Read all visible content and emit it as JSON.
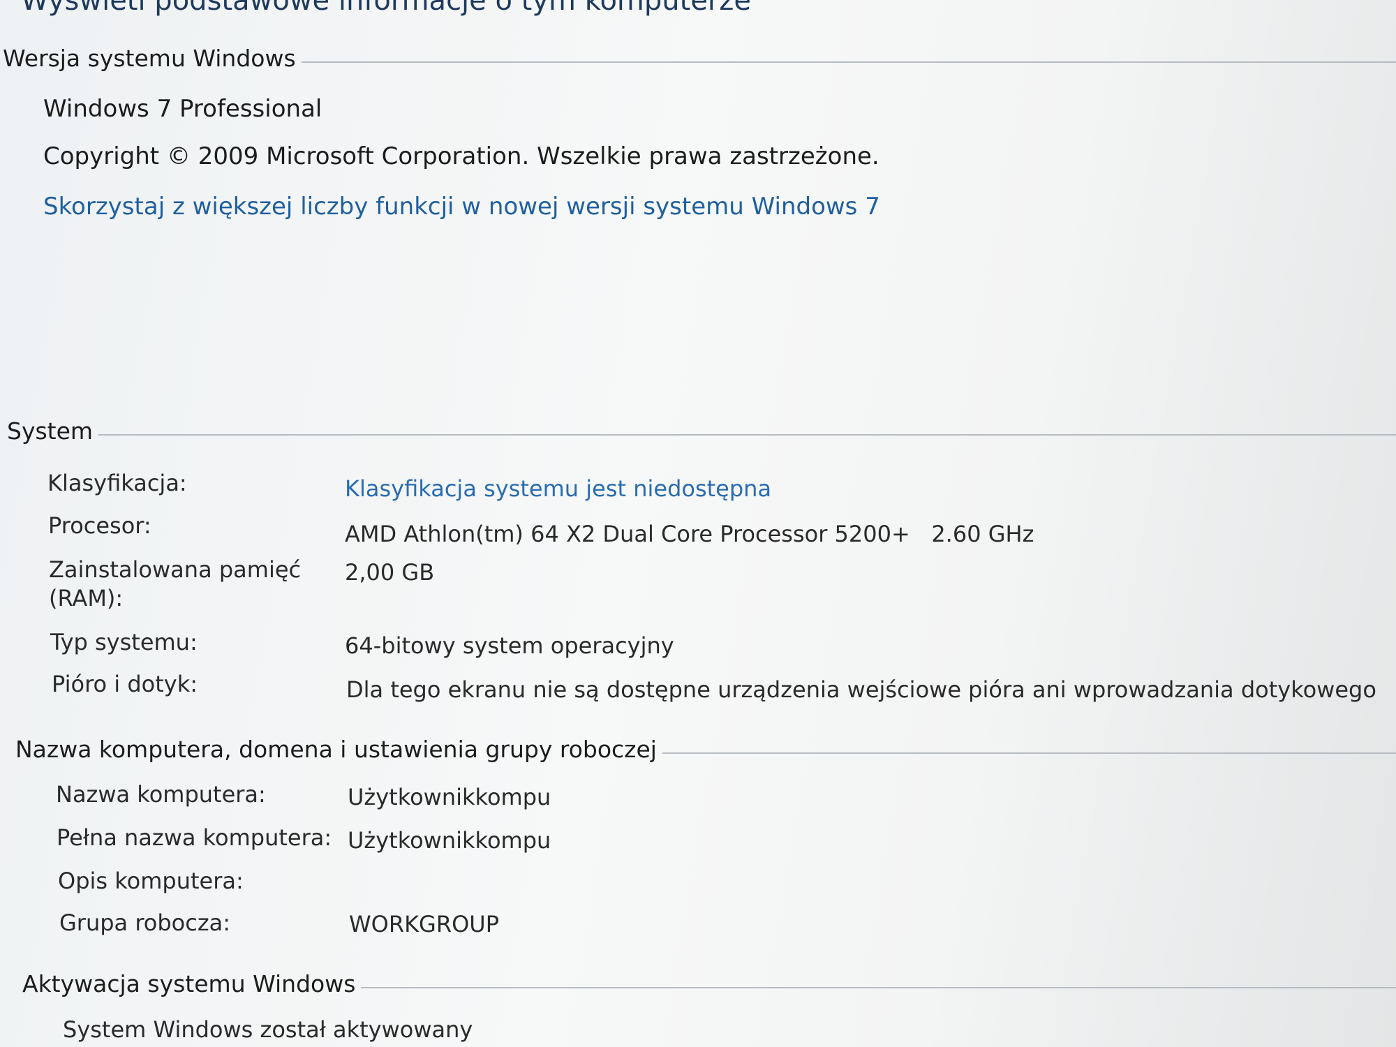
{
  "page": {
    "title": "Wyświetl podstawowe informacje o tym komputerze"
  },
  "windows_edition": {
    "header": "Wersja systemu Windows",
    "edition": "Windows 7 Professional",
    "copyright": "Copyright © 2009 Microsoft Corporation. Wszelkie prawa zastrzeżone.",
    "upgrade_link": "Skorzystaj z większej liczby funkcji w nowej wersji systemu Windows 7"
  },
  "system": {
    "header": "System",
    "rows": [
      {
        "label": "Klasyfikacja:",
        "value": "Klasyfikacja systemu jest niedostępna",
        "is_link": true
      },
      {
        "label": "Procesor:",
        "value": "AMD Athlon(tm) 64 X2 Dual Core Processor 5200+   2.60 GHz",
        "is_link": false
      },
      {
        "label": "Zainstalowana pamięć\n(RAM):",
        "value": "2,00 GB",
        "is_link": false
      },
      {
        "label": "Typ systemu:",
        "value": "64-bitowy system operacyjny",
        "is_link": false
      },
      {
        "label": "Pióro i dotyk:",
        "value": "Dla tego ekranu nie są dostępne urządzenia wejściowe pióra ani wprowadzania dotykowego",
        "is_link": false
      }
    ]
  },
  "computer_name": {
    "header": "Nazwa komputera, domena i ustawienia grupy roboczej",
    "rows": [
      {
        "label": "Nazwa komputera:",
        "value": "Użytkownikkompu"
      },
      {
        "label": "Pełna nazwa komputera:",
        "value": "Użytkownikkompu"
      },
      {
        "label": "Opis komputera:",
        "value": ""
      },
      {
        "label": "Grupa robocza:",
        "value": "WORKGROUP"
      }
    ]
  },
  "activation": {
    "header": "Aktywacja systemu Windows",
    "status": "System Windows został aktywowany"
  },
  "colors": {
    "link": "#1f5f9e",
    "text": "#1c1c1c",
    "title": "#1e3a5c",
    "divider": "#b7bcc1"
  }
}
